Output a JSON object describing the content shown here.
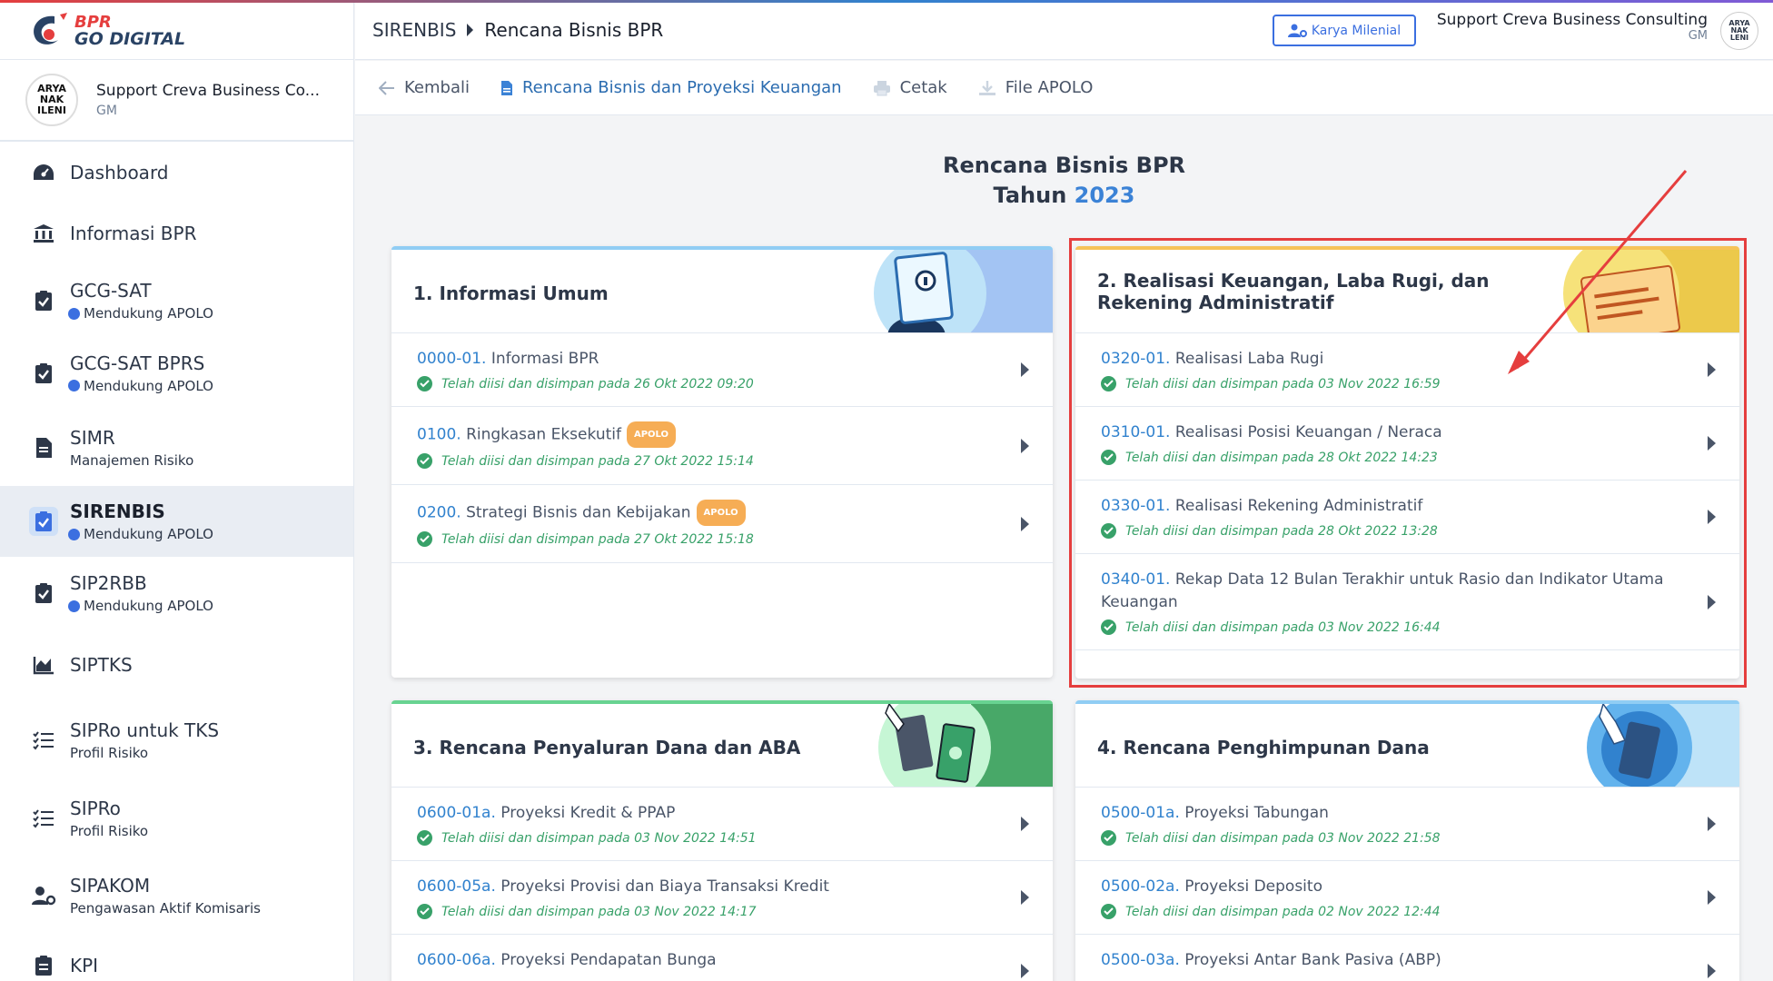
{
  "brand": {
    "line1": "BPR",
    "line2": "GO DIGITAL"
  },
  "profile": {
    "name": "Support Creva Business Co...",
    "role": "GM",
    "avatar_text": "ARYA NAK ILENI"
  },
  "sidebar": {
    "items": [
      {
        "label": "Dashboard",
        "sub": ""
      },
      {
        "label": "Informasi BPR",
        "sub": ""
      },
      {
        "label": "GCG-SAT",
        "sub": "Mendukung APOLO"
      },
      {
        "label": "GCG-SAT BPRS",
        "sub": "Mendukung APOLO"
      },
      {
        "label": "SIMR",
        "sub": "Manajemen Risiko"
      },
      {
        "label": "SIRENBIS",
        "sub": "Mendukung APOLO"
      },
      {
        "label": "SIP2RBB",
        "sub": "Mendukung APOLO"
      },
      {
        "label": "SIPTKS",
        "sub": ""
      },
      {
        "label": "SIPRo untuk TKS",
        "sub": "Profil Risiko"
      },
      {
        "label": "SIPRo",
        "sub": "Profil Risiko"
      },
      {
        "label": "SIPAKOM",
        "sub": "Pengawasan Aktif Komisaris"
      },
      {
        "label": "KPI",
        "sub": ""
      }
    ]
  },
  "header": {
    "breadcrumb_root": "SIRENBIS",
    "breadcrumb_current": "Rencana Bisnis BPR",
    "karya_button": "Karya Milenial",
    "user_name": "Support Creva Business Consulting",
    "user_role": "GM",
    "user_avatar_text": "ARYA NAK LENI"
  },
  "toolbar": {
    "back": "Kembali",
    "plan": "Rencana Bisnis dan Proyeksi Keuangan",
    "print": "Cetak",
    "file": "File APOLO"
  },
  "page": {
    "title": "Rencana Bisnis BPR",
    "year_prefix": "Tahun",
    "year": "2023"
  },
  "badge": "APOLO",
  "cards": [
    {
      "title": "1. Informasi Umum",
      "rows": [
        {
          "code": "0000-01.",
          "name": " Informasi BPR",
          "apolo": false,
          "status": "Telah diisi dan disimpan pada 26 Okt 2022 09:20"
        },
        {
          "code": "0100.",
          "name": " Ringkasan Eksekutif",
          "apolo": true,
          "status": "Telah diisi dan disimpan pada 27 Okt 2022 15:14"
        },
        {
          "code": "0200.",
          "name": " Strategi Bisnis dan Kebijakan",
          "apolo": true,
          "status": "Telah diisi dan disimpan pada 27 Okt 2022 15:18"
        }
      ]
    },
    {
      "title": "2. Realisasi Keuangan, Laba Rugi, dan Rekening Administratif",
      "rows": [
        {
          "code": "0320-01.",
          "name": " Realisasi Laba Rugi",
          "apolo": false,
          "status": "Telah diisi dan disimpan pada 03 Nov 2022 16:59"
        },
        {
          "code": "0310-01.",
          "name": " Realisasi Posisi Keuangan / Neraca",
          "apolo": false,
          "status": "Telah diisi dan disimpan pada 28 Okt 2022 14:23"
        },
        {
          "code": "0330-01.",
          "name": " Realisasi Rekening Administratif",
          "apolo": false,
          "status": "Telah diisi dan disimpan pada 28 Okt 2022 13:28"
        },
        {
          "code": "0340-01.",
          "name": " Rekap Data 12 Bulan Terakhir untuk Rasio dan Indikator Utama Keuangan",
          "apolo": false,
          "status": "Telah diisi dan disimpan pada 03 Nov 2022 16:44"
        }
      ]
    },
    {
      "title": "3. Rencana Penyaluran Dana dan ABA",
      "rows": [
        {
          "code": "0600-01a.",
          "name": " Proyeksi Kredit & PPAP",
          "apolo": false,
          "status": "Telah diisi dan disimpan pada 03 Nov 2022 14:51"
        },
        {
          "code": "0600-05a.",
          "name": " Proyeksi Provisi dan Biaya Transaksi Kredit",
          "apolo": false,
          "status": "Telah diisi dan disimpan pada 03 Nov 2022 14:17"
        },
        {
          "code": "0600-06a.",
          "name": " Proyeksi Pendapatan Bunga",
          "apolo": false,
          "status": ""
        }
      ]
    },
    {
      "title": "4. Rencana Penghimpunan Dana",
      "rows": [
        {
          "code": "0500-01a.",
          "name": " Proyeksi Tabungan",
          "apolo": false,
          "status": "Telah diisi dan disimpan pada 03 Nov 2022 21:58"
        },
        {
          "code": "0500-02a.",
          "name": " Proyeksi Deposito",
          "apolo": false,
          "status": "Telah diisi dan disimpan pada 02 Nov 2022 12:44"
        },
        {
          "code": "0500-03a.",
          "name": " Proyeksi Antar Bank Pasiva (ABP)",
          "apolo": false,
          "status": ""
        }
      ]
    }
  ],
  "colors": {
    "accent": "#3182ce",
    "success": "#38a169",
    "badge": "#f6ad55",
    "highlight": "#e53e3e"
  }
}
